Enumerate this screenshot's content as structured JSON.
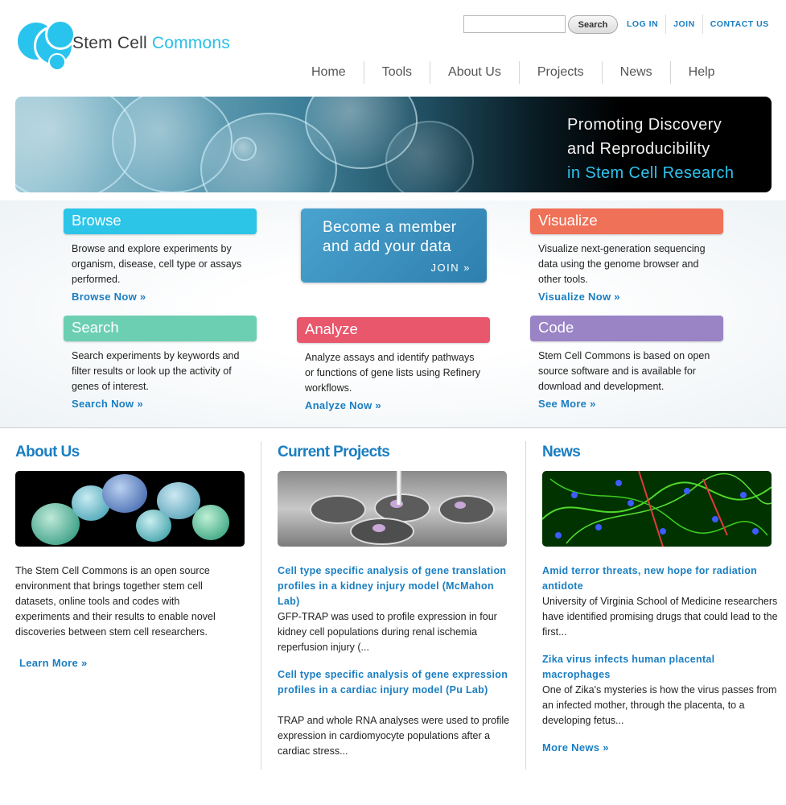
{
  "header": {
    "logo": {
      "part1": "Stem Cell ",
      "part2": "Commons"
    },
    "search": {
      "placeholder": "",
      "button_label": "Search"
    },
    "toplinks": [
      "LOG IN",
      "JOIN",
      "CONTACT US"
    ],
    "nav": [
      "Home",
      "Tools",
      "About Us",
      "Projects",
      "News",
      "Help"
    ]
  },
  "banner": {
    "line1": "Promoting Discovery",
    "line2": "and Reproducibility",
    "line3": "in Stem Cell Research"
  },
  "features": {
    "browse": {
      "title": "Browse",
      "desc": "Browse and explore experiments by organism, disease, cell type or assays performed.",
      "link": "Browse Now »",
      "color": "#2cc5e8"
    },
    "member": {
      "line1": "Become a member",
      "line2": "and add your data",
      "link": "JOIN »"
    },
    "visualize": {
      "title": "Visualize",
      "desc": "Visualize next-generation sequencing data using the genome browser and other tools.",
      "link": "Visualize Now »",
      "color": "#ef7157"
    },
    "search": {
      "title": "Search",
      "desc": "Search experiments by keywords and filter results or look up the activity of genes of interest.",
      "link": "Search Now »",
      "color": "#6ccfb2"
    },
    "analyze": {
      "title": "Analyze",
      "desc": "Analyze assays and identify pathways or functions of gene lists using Refinery workflows.",
      "link": "Analyze Now »",
      "color": "#e8576c"
    },
    "code": {
      "title": "Code",
      "desc": "Stem Cell Commons is based on open source software and is available for download and development.",
      "link": "See More »",
      "color": "#9a84c6"
    }
  },
  "about": {
    "heading": "About Us",
    "text": "The Stem Cell Commons is an open source environment that brings together stem cell datasets, online tools and codes with experiments and their results to enable novel discoveries between stem cell researchers.",
    "link": "Learn More »"
  },
  "projects": {
    "heading": "Current Projects",
    "items": [
      {
        "title": "Cell type specific analysis of gene translation profiles in a kidney injury model (McMahon Lab)",
        "text": "GFP-TRAP was used to profile expression in four kidney cell populations during renal ischemia reperfusion injury (..."
      },
      {
        "title": "Cell type specific analysis of gene expression profiles in a cardiac injury model (Pu Lab)",
        "text": "TRAP and whole RNA analyses were used to profile expression in cardiomyocyte populations after a cardiac stress..."
      }
    ]
  },
  "news": {
    "heading": "News",
    "items": [
      {
        "title": "Amid terror threats, new hope for radiation antidote",
        "text": "University of Virginia School of Medicine researchers have identified promising drugs that could lead to the first..."
      },
      {
        "title": "Zika virus infects human placental macrophages",
        "text": "One of Zika's mysteries is how the virus passes from an infected mother, through the placenta, to a developing fetus..."
      }
    ],
    "link": "More News »"
  }
}
